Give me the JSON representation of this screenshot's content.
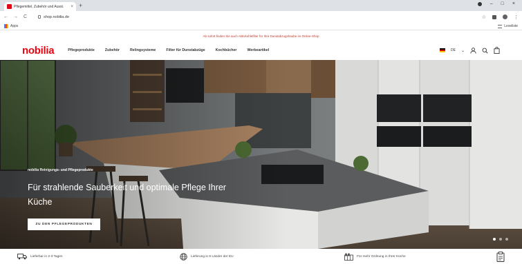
{
  "browser": {
    "tab_title": "Pflegemittel, Zubehör und Ausst.",
    "tab_close": "×",
    "new_tab": "+",
    "nav_back": "←",
    "nav_forward": "→",
    "nav_reload": "C",
    "url": "shop.nobilia.de",
    "bookmark_apps": "Apps",
    "bookmark_reading_list": "Leseliste",
    "win_min": "–",
    "win_max": "□",
    "win_close": "×"
  },
  "promo": {
    "text": "Ab sofort finden Sie auch Aktivkohlefilter für Ihre Dunstabzugshaube im Online-Shop"
  },
  "header": {
    "logo": "nobilia",
    "nav": [
      {
        "label": "Pflegeprodukte"
      },
      {
        "label": "Zubehör"
      },
      {
        "label": "Relingsysteme"
      },
      {
        "label": "Filter für Dunstabzüge"
      },
      {
        "label": "Kochbücher"
      },
      {
        "label": "Werbeartikel"
      }
    ],
    "lang": "DE"
  },
  "hero": {
    "eyebrow": "nobilia Reinigungs- und Pflegeprodukte",
    "title": "Für strahlende Sauberkeit und optimale Pflege Ihrer Küche",
    "button": "ZU DEN PFLEGEPRODUKTEN",
    "slides_total": 3,
    "active_slide": 0
  },
  "usp": [
    {
      "label": "Lieferbar in 2-3 Tagen",
      "icon": "truck-icon"
    },
    {
      "label": "Lieferung in 6 Länder der EU",
      "icon": "globe-icon"
    },
    {
      "label": "Für mehr Ordnung in Ihrer Küche",
      "icon": "organizer-icon"
    }
  ],
  "colors": {
    "brand_red": "#e30613",
    "promo_red": "#c0392b"
  }
}
